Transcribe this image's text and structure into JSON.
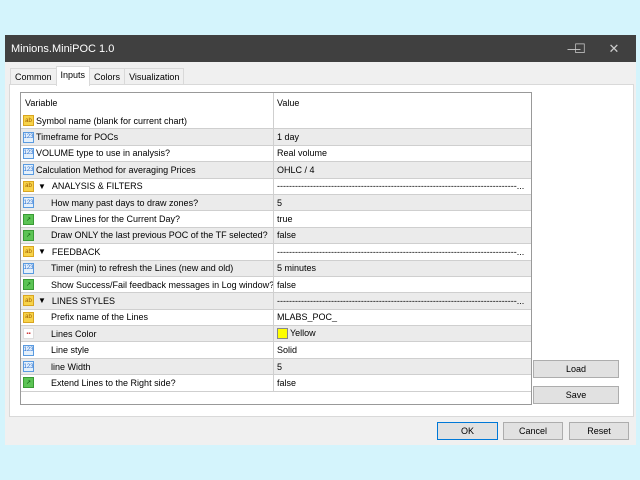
{
  "window": {
    "title": "Minions.MiniPOC 1.0",
    "minimize": "—",
    "maximize": "☐",
    "close": "✕"
  },
  "tabs": [
    "Common",
    "Inputs",
    "Colors",
    "Visualization"
  ],
  "grid": {
    "headers": {
      "variable": "Variable",
      "value": "Value"
    },
    "rows": [
      {
        "icon": "ab",
        "name": "Symbol name (blank for current chart)",
        "value": ""
      },
      {
        "icon": "123",
        "name": "Timeframe for POCs",
        "value": "1 day"
      },
      {
        "icon": "123",
        "name": "VOLUME type to use in analysis?",
        "value": "Real volume"
      },
      {
        "icon": "123",
        "name": "Calculation Method for averaging Prices",
        "value": "OHLC / 4"
      },
      {
        "icon": "ab",
        "group": true,
        "name": "ANALYSIS & FILTERS",
        "value": "--------------------------------------------------------------------------------..."
      },
      {
        "icon": "123",
        "indent": true,
        "name": "How many past days to draw zones?",
        "value": "5"
      },
      {
        "icon": "bool",
        "indent": true,
        "name": "Draw Lines for the Current Day?",
        "value": "true"
      },
      {
        "icon": "bool",
        "indent": true,
        "name": "Draw ONLY the last previous POC of the TF selected?",
        "value": "false"
      },
      {
        "icon": "ab",
        "group": true,
        "name": "FEEDBACK",
        "value": "--------------------------------------------------------------------------------..."
      },
      {
        "icon": "123",
        "indent": true,
        "name": "Timer (min) to refresh the Lines (new and old)",
        "value": "5 minutes"
      },
      {
        "icon": "bool",
        "indent": true,
        "name": "Show Success/Fail feedback messages in Log window?",
        "value": "false"
      },
      {
        "icon": "ab",
        "group": true,
        "name": "LINES STYLES",
        "value": "--------------------------------------------------------------------------------..."
      },
      {
        "icon": "ab",
        "indent": true,
        "name": "Prefix name of the Lines",
        "value": "MLABS_POC_"
      },
      {
        "icon": "color",
        "indent": true,
        "name": "Lines Color",
        "value": "Yellow",
        "swatch": "#ffff00"
      },
      {
        "icon": "123",
        "indent": true,
        "name": "Line style",
        "value": "Solid"
      },
      {
        "icon": "123",
        "indent": true,
        "name": "line Width",
        "value": "5"
      },
      {
        "icon": "bool",
        "indent": true,
        "name": "Extend Lines to the Right side?",
        "value": "false"
      }
    ]
  },
  "buttons": {
    "load": "Load",
    "save": "Save",
    "ok": "OK",
    "cancel": "Cancel",
    "reset": "Reset"
  }
}
